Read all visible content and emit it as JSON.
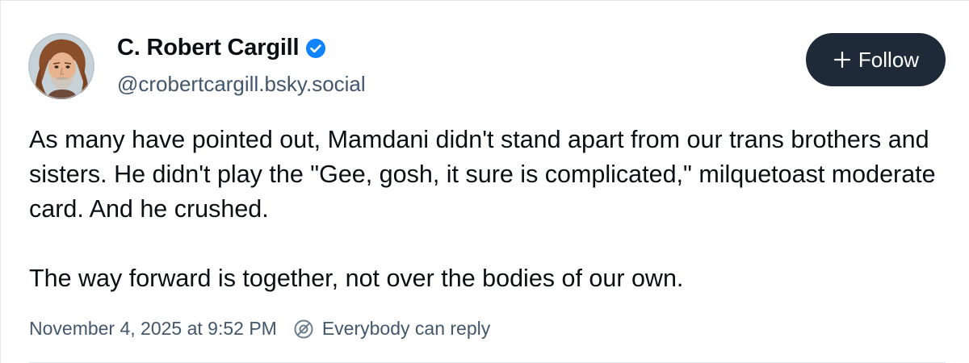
{
  "post": {
    "author": {
      "display_name": "C. Robert Cargill",
      "handle": "@crobertcargill.bsky.social",
      "verified": true,
      "avatar": "avatar-illustration"
    },
    "follow_button": {
      "label": "Follow",
      "icon": "plus-icon"
    },
    "text_paragraphs": [
      "As many have pointed out, Mamdani didn't stand apart from our trans brothers and sisters. He didn't play the \"Gee, gosh, it sure is complicated,\" milquetoast moderate card. And he crushed.",
      "The way forward is together, not over the bodies of our own."
    ],
    "timestamp": "November 4, 2025 at 9:52 PM",
    "reply_setting": {
      "label": "Everybody can reply",
      "icon": "reply-settings-icon"
    }
  },
  "colors": {
    "text_primary": "#0b0f14",
    "text_secondary": "#42576c",
    "follow_bg": "#1e2a38",
    "verified_blue": "#1083fe",
    "divider": "#e4e8ee"
  }
}
